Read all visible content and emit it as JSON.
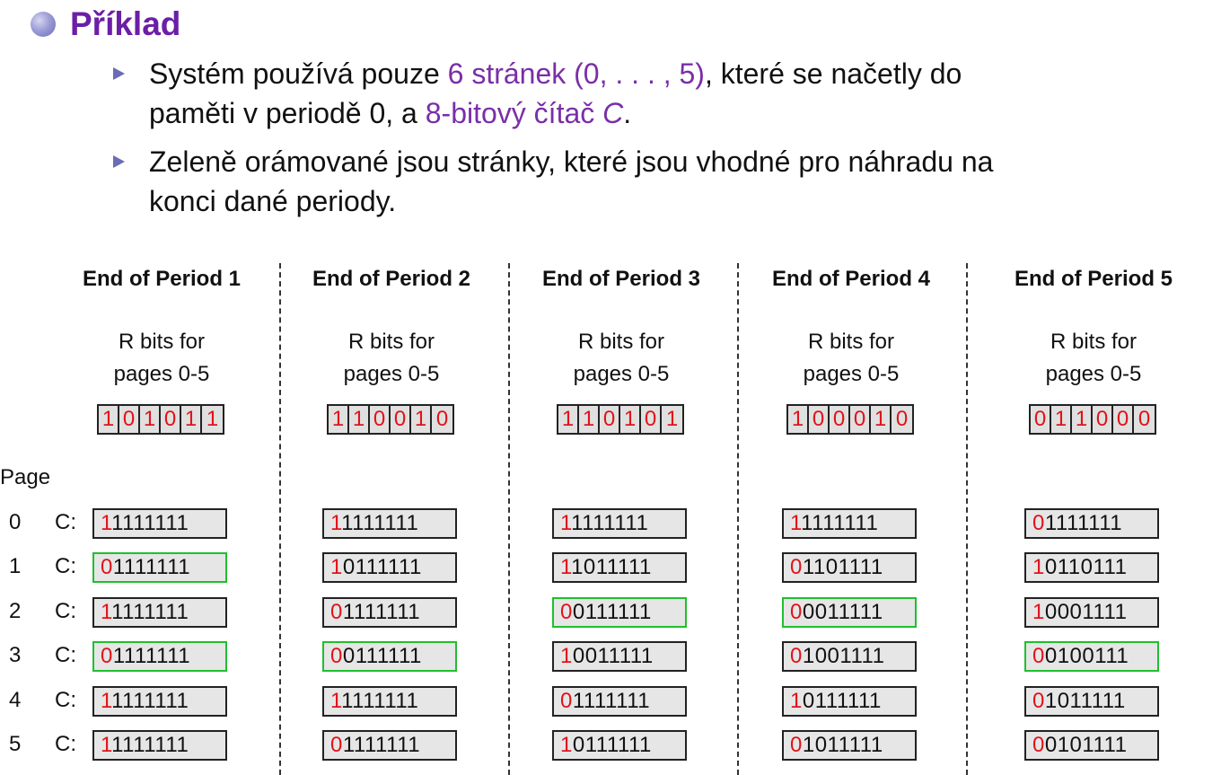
{
  "heading": {
    "title": "Příklad"
  },
  "bullets": [
    {
      "line1_a": "Systém používá pouze ",
      "line1_b": "6 stránek (0, . . . , 5)",
      "line1_c": ", které se načetly do",
      "line2_a": "paměti v periodě 0, a ",
      "line2_b": "8-bitový čítač ",
      "line2_c": "C",
      "line2_d": "."
    },
    {
      "line1": "Zeleně orámované jsou stránky, které jsou vhodné pro náhradu na",
      "line2": "konci dané periody."
    }
  ],
  "diagram": {
    "page_label": "Page",
    "c_label": "C:",
    "rbits_label_line1": "R bits for",
    "rbits_label_line2": "pages 0-5",
    "page_numbers": [
      "0",
      "1",
      "2",
      "3",
      "4",
      "5"
    ],
    "periods": [
      {
        "title": "End of Period 1",
        "rbits": [
          "1",
          "0",
          "1",
          "0",
          "1",
          "1"
        ],
        "counters": [
          "11111111",
          "01111111",
          "11111111",
          "01111111",
          "11111111",
          "11111111"
        ],
        "highlighted": [
          false,
          true,
          false,
          true,
          false,
          false
        ]
      },
      {
        "title": "End of Period 2",
        "rbits": [
          "1",
          "1",
          "0",
          "0",
          "1",
          "0"
        ],
        "counters": [
          "11111111",
          "10111111",
          "01111111",
          "00111111",
          "11111111",
          "01111111"
        ],
        "highlighted": [
          false,
          false,
          false,
          true,
          false,
          false
        ]
      },
      {
        "title": "End of Period 3",
        "rbits": [
          "1",
          "1",
          "0",
          "1",
          "0",
          "1"
        ],
        "counters": [
          "11111111",
          "11011111",
          "00111111",
          "10011111",
          "01111111",
          "10111111"
        ],
        "highlighted": [
          false,
          false,
          true,
          false,
          false,
          false
        ]
      },
      {
        "title": "End of Period 4",
        "rbits": [
          "1",
          "0",
          "0",
          "0",
          "1",
          "0"
        ],
        "counters": [
          "11111111",
          "01101111",
          "00011111",
          "01001111",
          "10111111",
          "01011111"
        ],
        "highlighted": [
          false,
          false,
          true,
          false,
          false,
          false
        ]
      },
      {
        "title": "End of Period 5",
        "rbits": [
          "0",
          "1",
          "1",
          "0",
          "0",
          "0"
        ],
        "counters": [
          "01111111",
          "10110111",
          "10001111",
          "00100111",
          "01011111",
          "00101111"
        ],
        "highlighted": [
          false,
          false,
          false,
          true,
          false,
          false
        ]
      }
    ],
    "colors": {
      "bit_red": "#e0131a",
      "highlight_green": "#1fbf2e",
      "accent_purple": "#7a2ea8"
    }
  }
}
